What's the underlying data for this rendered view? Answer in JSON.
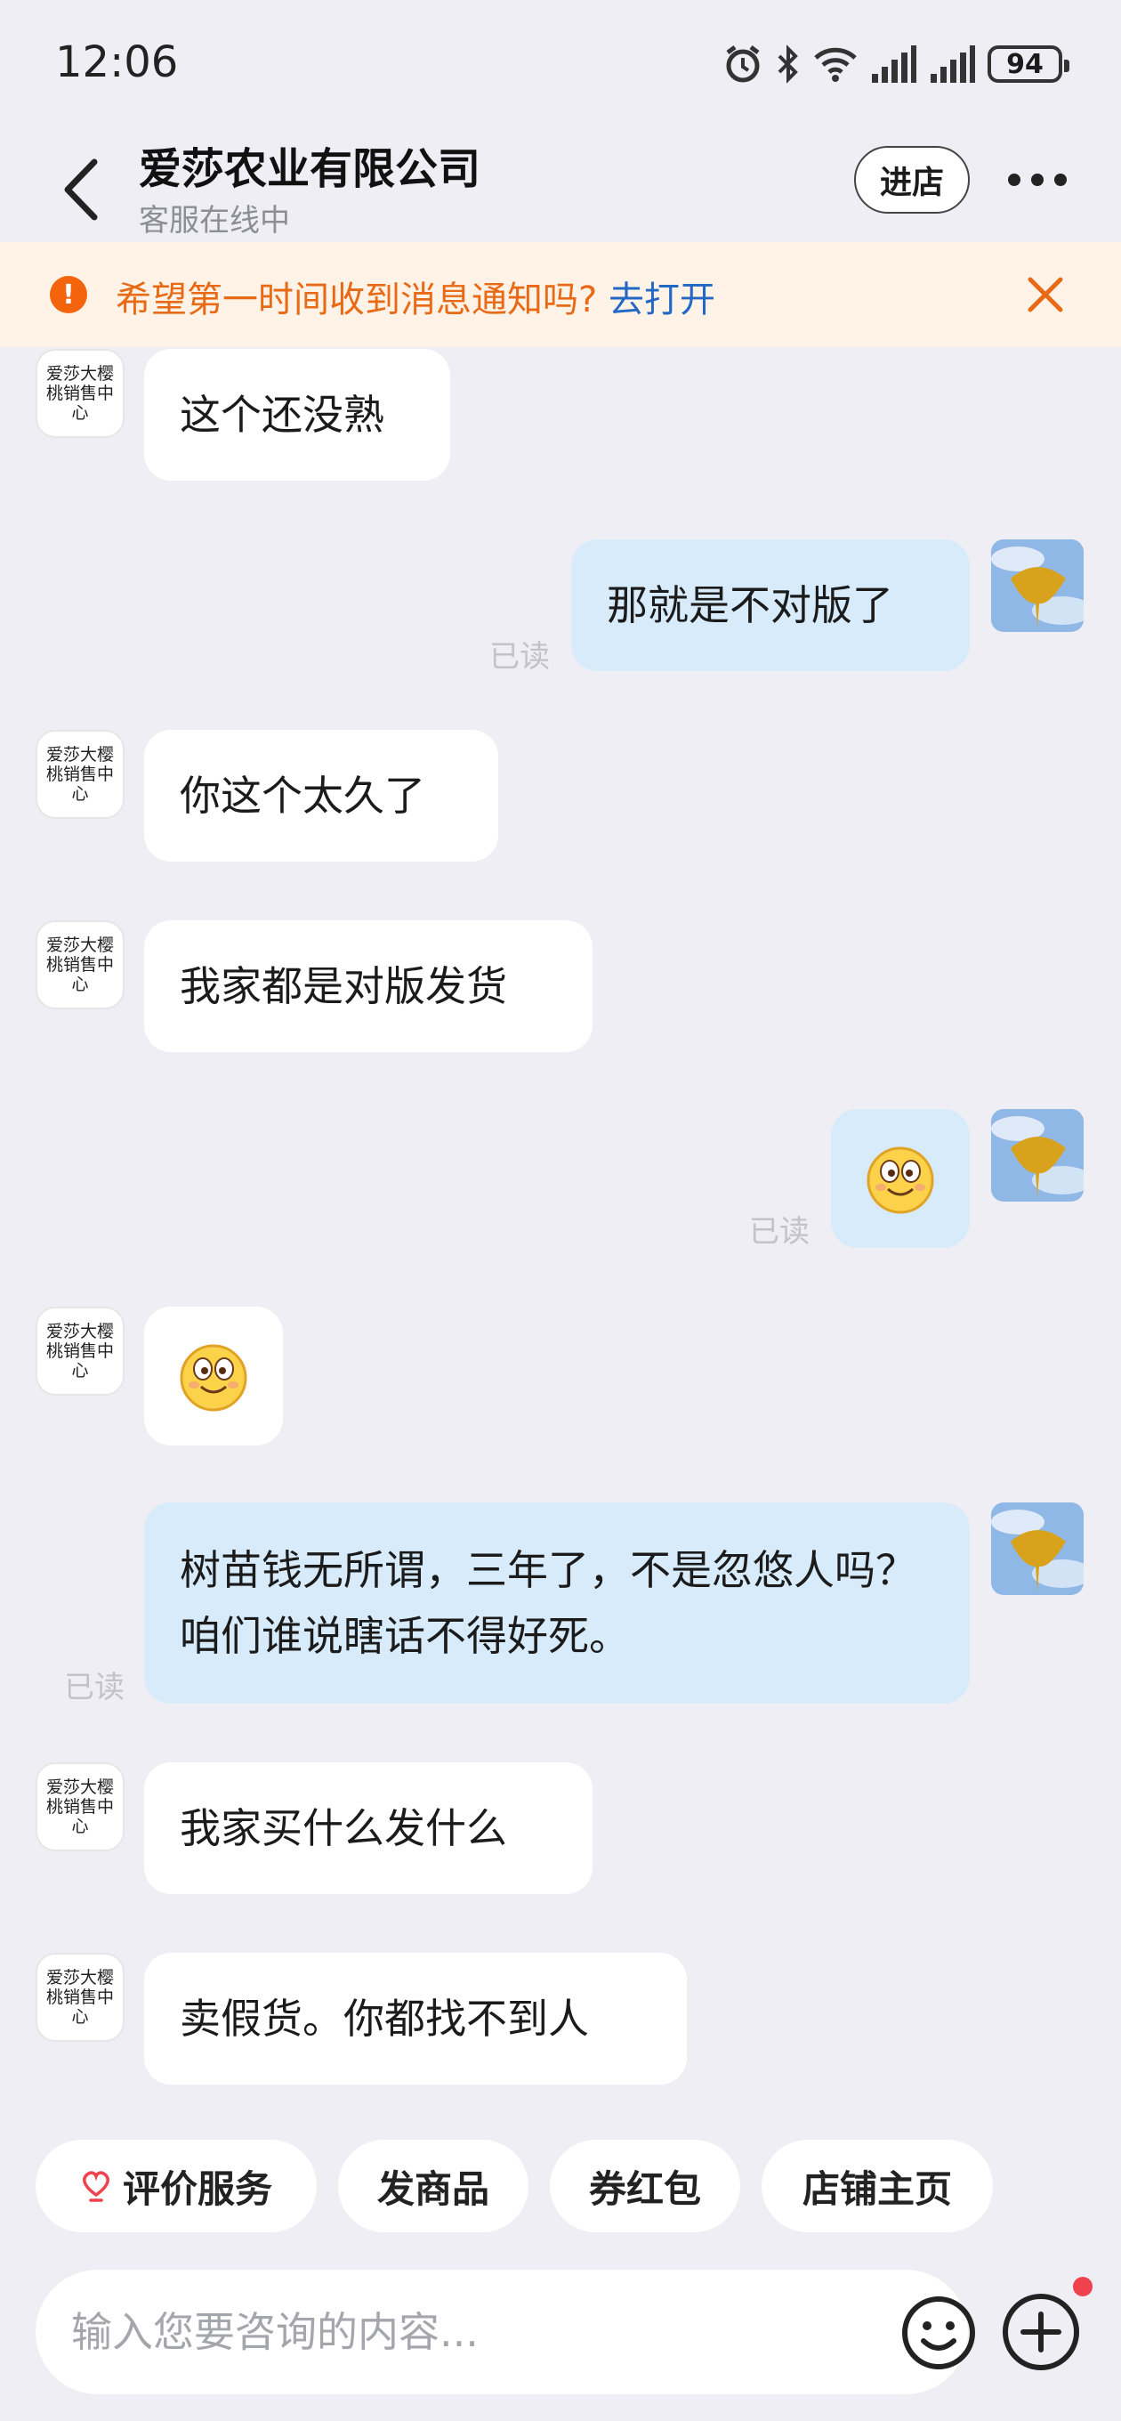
{
  "status_bar": {
    "time": "12:06",
    "battery": "94"
  },
  "header": {
    "title": "爱莎农业有限公司",
    "subtitle": "客服在线中",
    "enter_store": "进店"
  },
  "notice": {
    "text": "希望第一时间收到消息通知吗?",
    "link": "去打开"
  },
  "shop_avatar_text": "爱莎大樱桃销售中心",
  "read_label": "已读",
  "messages": [
    {
      "from": "shop",
      "text": "这个还没熟"
    },
    {
      "from": "me",
      "text": "那就是不对版了",
      "read": "已读"
    },
    {
      "from": "shop",
      "text": "你这个太久了"
    },
    {
      "from": "shop",
      "text": "我家都是对版发货"
    },
    {
      "from": "me",
      "emoji": "smile",
      "read": "已读"
    },
    {
      "from": "shop",
      "emoji": "smile"
    },
    {
      "from": "me",
      "text": "树苗钱无所谓，三年了，不是忽悠人吗？咱们谁说瞎话不得好死。",
      "read": "已读"
    },
    {
      "from": "shop",
      "text": "我家买什么发什么"
    },
    {
      "from": "shop",
      "text": "卖假货。你都找不到人"
    }
  ],
  "quick_actions": [
    "评价服务",
    "发商品",
    "券红包",
    "店铺主页"
  ],
  "input": {
    "placeholder": "输入您要咨询的内容..."
  },
  "colors": {
    "accent_orange": "#E86A16",
    "link_blue": "#2468C6",
    "bubble_out": "#D7EBFA",
    "bg": "#EEEEF4"
  }
}
